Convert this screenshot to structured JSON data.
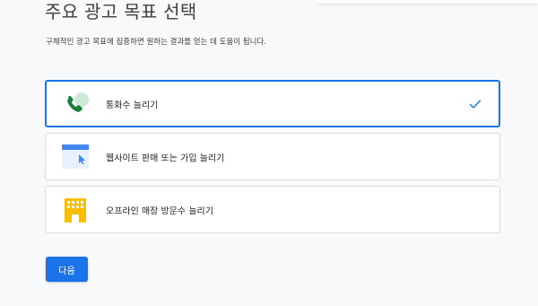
{
  "header": {
    "title": "주요 광고 목표 선택",
    "subtitle": "구체적인 광고 목표에 집중하면 원하는 결과를 얻는 데 도움이 됩니다."
  },
  "options": [
    {
      "label": "통화수 늘리기",
      "icon": "phone-call-icon",
      "selected": true
    },
    {
      "label": "웹사이트 판매 또는 가입 늘리기",
      "icon": "website-cursor-icon",
      "selected": false
    },
    {
      "label": "오프라인 매장 방문수 늘리기",
      "icon": "store-building-icon",
      "selected": false
    }
  ],
  "actions": {
    "next_label": "다음"
  },
  "colors": {
    "accent": "#1a73e8",
    "phone_green": "#188038",
    "phone_light_green": "#ceead6",
    "website_blue": "#4285f4",
    "website_light": "#e8f0fe",
    "store_yellow": "#fbbc04"
  }
}
